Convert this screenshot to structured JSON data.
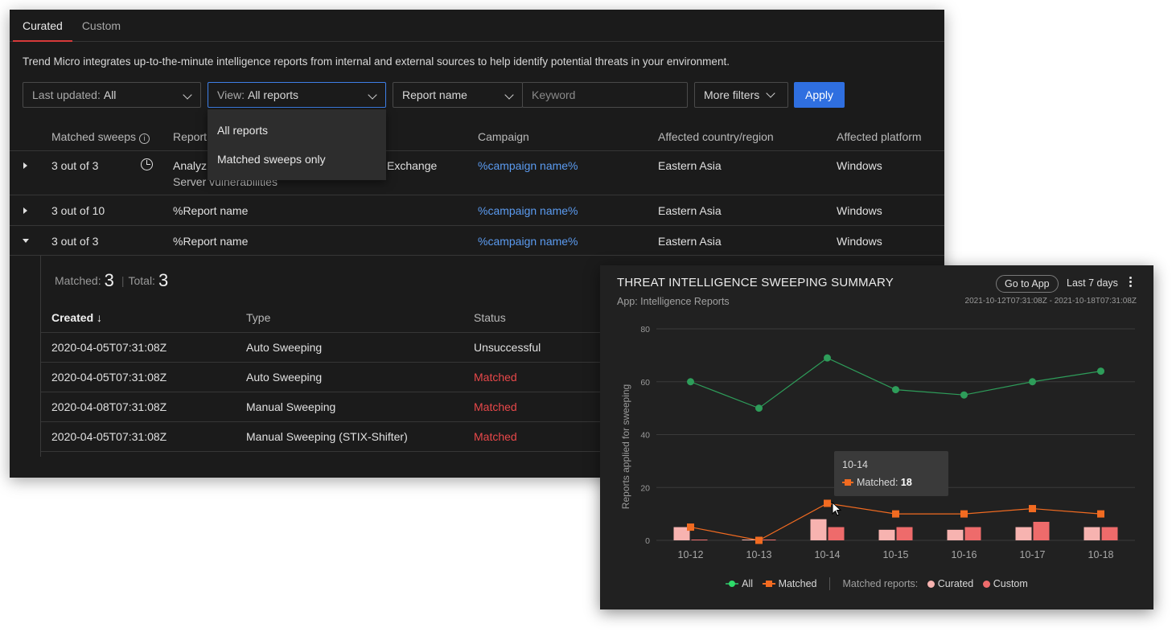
{
  "tabs": [
    "Curated",
    "Custom"
  ],
  "description": "Trend Micro integrates up-to-the-minute intelligence reports from internal and external sources to help identify potential threats in your environment.",
  "filters": {
    "last_updated_label": "Last updated:",
    "last_updated_value": "All",
    "view_label": "View:",
    "view_value": "All reports",
    "field_select": "Report name",
    "keyword_placeholder": "Keyword",
    "more_filters": "More filters",
    "apply": "Apply"
  },
  "view_dropdown": [
    "All reports",
    "Matched sweeps only"
  ],
  "table": {
    "columns": [
      "Matched sweeps",
      "Report",
      "Campaign",
      "Affected country/region",
      "Affected platform"
    ],
    "rows": [
      {
        "matched": "3 out of 3",
        "report_l1": "Analyz",
        "report_l1_tail": "Exchange",
        "report_l2": "Server vulnerabilities",
        "campaign": "%campaign name%",
        "region": "Eastern Asia",
        "platform": "Windows"
      },
      {
        "matched": "3 out of 10",
        "report": "%Report name",
        "campaign": "%campaign name%",
        "region": "Eastern Asia",
        "platform": "Windows"
      },
      {
        "matched": "3 out of 3",
        "report": "%Report name",
        "campaign": "%campaign name%",
        "region": "Eastern Asia",
        "platform": "Windows"
      }
    ]
  },
  "expanded": {
    "matched_label": "Matched:",
    "matched_value": "3",
    "total_label": "Total:",
    "total_value": "3",
    "columns": [
      "Created",
      "Type",
      "Status"
    ],
    "rows": [
      {
        "created": "2020-04-05T07:31:08Z",
        "type": "Auto Sweeping",
        "status": "Unsuccessful"
      },
      {
        "created": "2020-04-05T07:31:08Z",
        "type": "Auto Sweeping",
        "status": "Matched"
      },
      {
        "created": "2020-04-08T07:31:08Z",
        "type": "Manual Sweeping",
        "status": "Matched"
      },
      {
        "created": "2020-04-05T07:31:08Z",
        "type": "Manual Sweeping (STIX-Shifter)",
        "status": "Matched"
      }
    ]
  },
  "card": {
    "title": "THREAT INTELLIGENCE SWEEPING SUMMARY",
    "subtitle": "App: Intelligence Reports",
    "go_to_app": "Go to App",
    "range": "Last 7 days",
    "date_range": "2021-10-12T07:31:08Z - 2021-10-18T07:31:08Z",
    "tooltip_date": "10-14",
    "tooltip_label": "Matched:",
    "tooltip_value": "18",
    "legend": {
      "all": "All",
      "matched": "Matched",
      "reports_label": "Matched reports:",
      "curated": "Curated",
      "custom": "Custom"
    }
  },
  "colors": {
    "all": "#2e9d5a",
    "matched": "#f26b21",
    "curated": "#f7b3b0",
    "custom": "#ee6b6b",
    "accent": "#2f6fe0",
    "tab_active": "#d63a3a",
    "link": "#5b9bf0",
    "status_matched": "#e8484a"
  },
  "chart_data": {
    "type": "line",
    "ylabel": "Reports applied for sweeping",
    "ylim": [
      0,
      80
    ],
    "yticks": [
      0,
      20,
      40,
      60,
      80
    ],
    "categories": [
      "10-12",
      "10-13",
      "10-14",
      "10-15",
      "10-16",
      "10-17",
      "10-18"
    ],
    "series": [
      {
        "name": "All",
        "type": "line",
        "values": [
          60,
          50,
          69,
          57,
          55,
          60,
          64
        ]
      },
      {
        "name": "Matched",
        "type": "line",
        "values": [
          5,
          0,
          14,
          10,
          10,
          12,
          10
        ]
      },
      {
        "name": "Curated",
        "type": "bar",
        "values": [
          5,
          0,
          8,
          4,
          4,
          5,
          5
        ]
      },
      {
        "name": "Custom",
        "type": "bar",
        "values": [
          0,
          0,
          5,
          5,
          5,
          7,
          5
        ]
      }
    ]
  }
}
